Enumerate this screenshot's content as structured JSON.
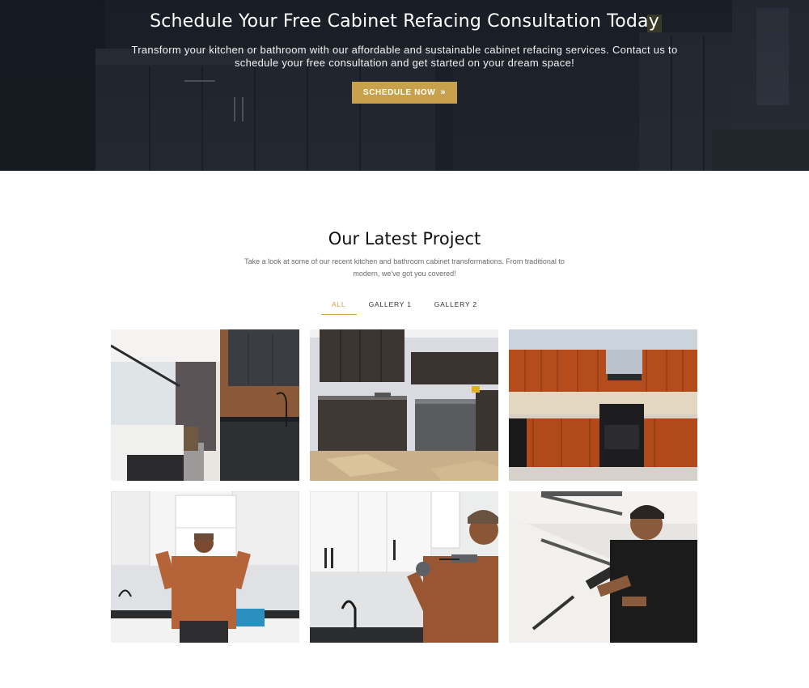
{
  "hero": {
    "title": "Schedule Your Free Cabinet Refacing Consultation Today",
    "subtitle": "Transform your kitchen or bathroom with our affordable and sustainable cabinet refacing services. Contact us to schedule your free consultation and get started on your dream space!",
    "button_label": "SCHEDULE NOW",
    "button_icon": "double-chevron-right-icon",
    "accent_color": "#c9a04c"
  },
  "projects": {
    "title": "Our Latest Project",
    "description": "Take a look at some of our recent kitchen and bathroom cabinet transformations. From traditional to modern, we've got you covered!",
    "filters": [
      {
        "label": "ALL",
        "active": true
      },
      {
        "label": "GALLERY 1",
        "active": false
      },
      {
        "label": "GALLERY 2",
        "active": false
      }
    ]
  }
}
